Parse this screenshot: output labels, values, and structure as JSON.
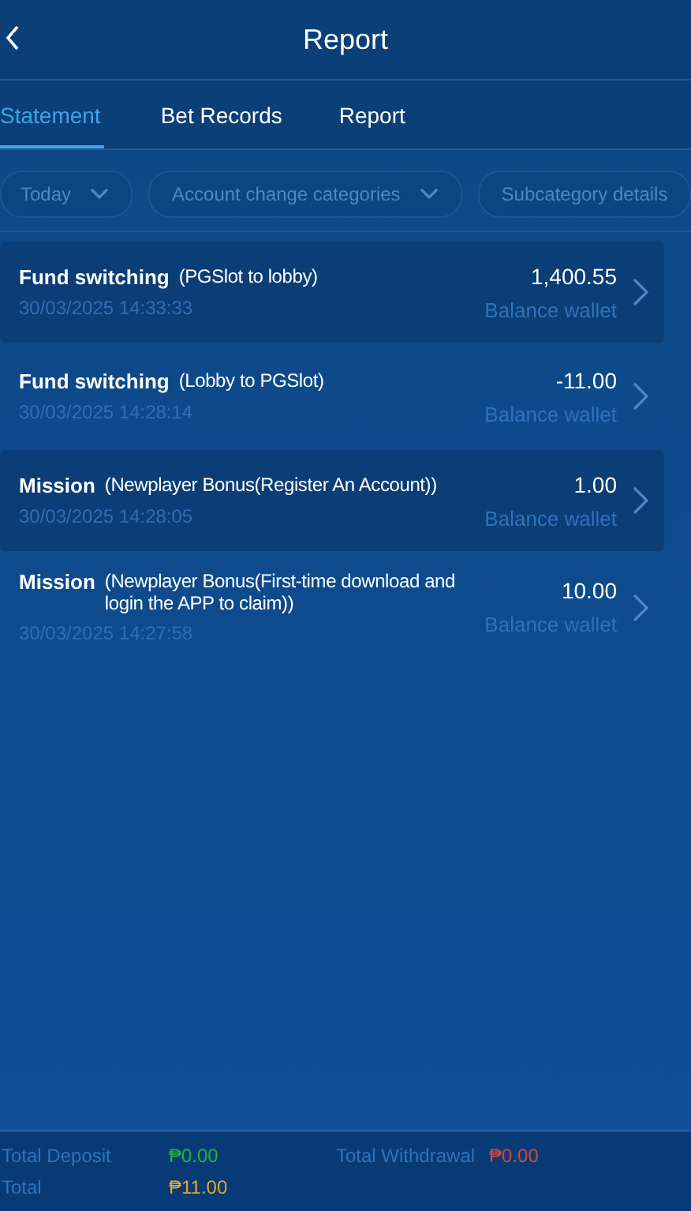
{
  "header": {
    "title": "Report"
  },
  "tabs": [
    {
      "label": "Statement",
      "selected": true
    },
    {
      "label": "Bet Records",
      "selected": false
    },
    {
      "label": "Report",
      "selected": false
    }
  ],
  "filters": [
    {
      "label": "Today",
      "dropdown": true
    },
    {
      "label": "Account change categories",
      "dropdown": true
    },
    {
      "label": "Subcategory details",
      "dropdown": false
    }
  ],
  "records": [
    {
      "type": "Fund switching",
      "detail": "(PGSlot to lobby)",
      "time": "30/03/2025 14:33:33",
      "amount": "1,400.55",
      "wallet": "Balance wallet"
    },
    {
      "type": "Fund switching",
      "detail": "(Lobby to PGSlot)",
      "time": "30/03/2025 14:28:14",
      "amount": "-11.00",
      "wallet": "Balance wallet"
    },
    {
      "type": "Mission",
      "detail": "(Newplayer Bonus(Register An Account))",
      "time": "30/03/2025 14:28:05",
      "amount": "1.00",
      "wallet": "Balance wallet"
    },
    {
      "type": "Mission",
      "detail": "(Newplayer Bonus(First-time download and login the APP to claim))",
      "time": "30/03/2025 14:27:58",
      "amount": "10.00",
      "wallet": "Balance wallet"
    }
  ],
  "summary": [
    {
      "label": "Total Deposit",
      "value": "₱0.00",
      "kind": "deposit"
    },
    {
      "label": "Total Withdrawal",
      "value": "₱0.00",
      "kind": "withdrawal"
    },
    {
      "label": "Total",
      "value": "₱11.00",
      "kind": "total"
    }
  ]
}
